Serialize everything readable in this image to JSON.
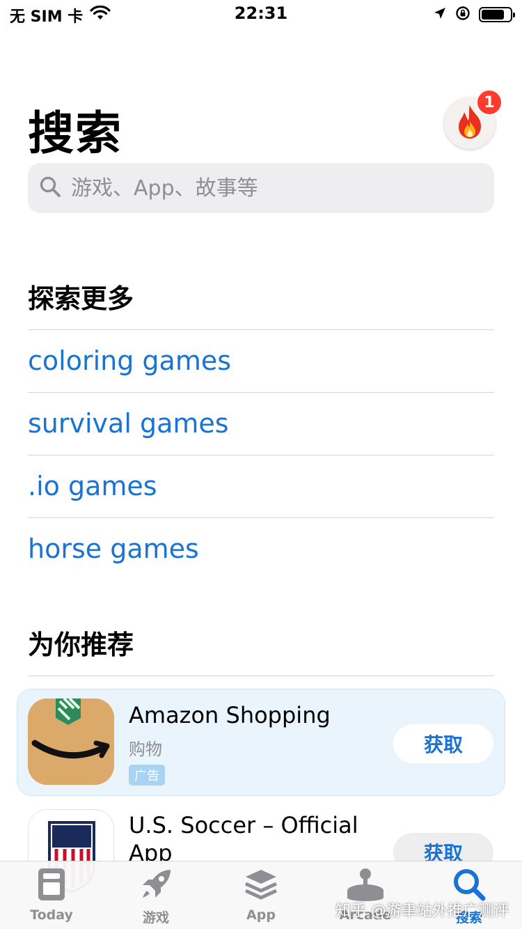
{
  "status_bar": {
    "carrier": "无 SIM 卡",
    "time": "22:31",
    "battery_level": 0.8
  },
  "header": {
    "title": "搜索",
    "notification_count": "1"
  },
  "search": {
    "placeholder": "游戏、App、故事等"
  },
  "explore": {
    "title": "探索更多",
    "items": [
      {
        "label": "coloring games"
      },
      {
        "label": "survival games"
      },
      {
        "label": ".io games"
      },
      {
        "label": "horse games"
      }
    ]
  },
  "recommended": {
    "title": "为你推荐",
    "apps": [
      {
        "name": "Amazon Shopping",
        "category": "购物",
        "ad_label": "广告",
        "action": "获取"
      },
      {
        "name_line1": "U.S. Soccer – Official",
        "name_line2": "App",
        "action": "获取"
      }
    ]
  },
  "tabbar": {
    "items": [
      {
        "label": "Today",
        "icon": "today-icon"
      },
      {
        "label": "游戏",
        "icon": "rocket-icon"
      },
      {
        "label": "App",
        "icon": "layers-icon"
      },
      {
        "label": "Arcade",
        "icon": "joystick-icon"
      },
      {
        "label": "搜索",
        "icon": "search-icon",
        "active": true
      }
    ]
  },
  "watermark": "知乎 @游聿站外推广测评",
  "colors": {
    "accent": "#1a73d2",
    "badge": "#ff3b30",
    "ad_card_bg": "#eaf4fd"
  }
}
